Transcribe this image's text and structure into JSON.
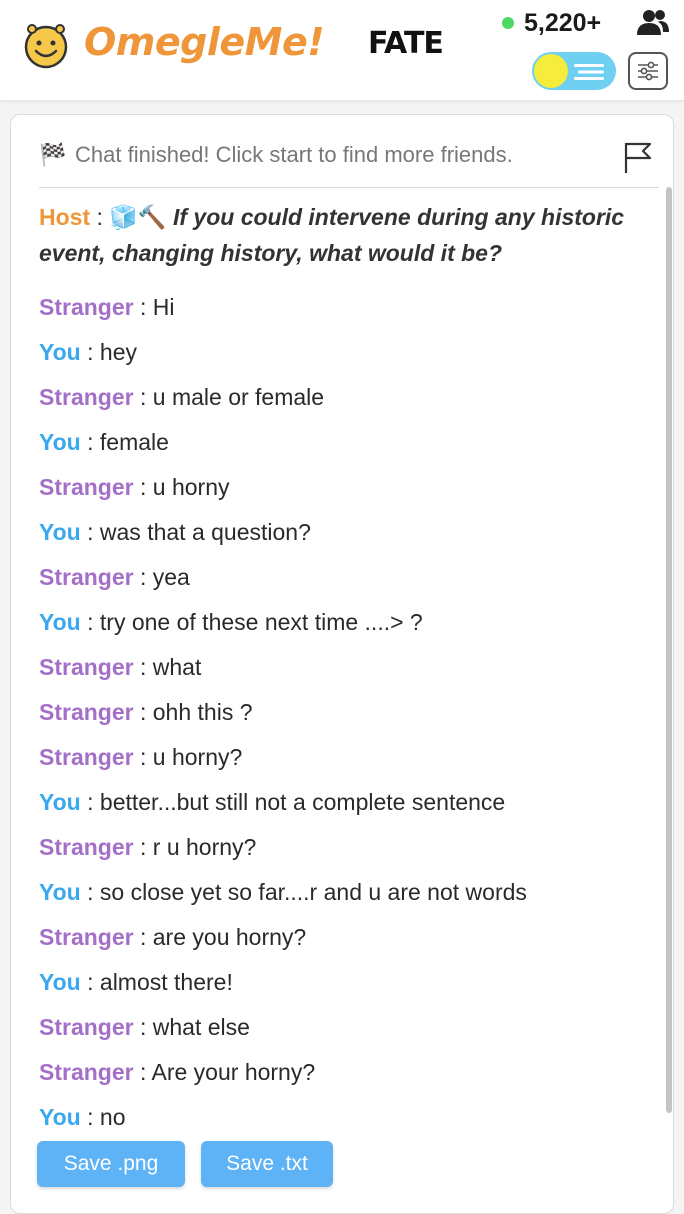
{
  "header": {
    "logo_text": "OmegleMe!",
    "brand_word": "FATE",
    "online_count": "5,220+",
    "online_color": "#4cd964",
    "accent_color": "#f0963a"
  },
  "status": {
    "flag_icon": "🏁",
    "text": "Chat finished! Click start to find more friends."
  },
  "host_message": {
    "name": "Host",
    "icons": "🧊🔨",
    "text": "If you could intervene during any historic event, changing history, what would it be?"
  },
  "messages": [
    {
      "speaker": "Stranger",
      "text": "Hi"
    },
    {
      "speaker": "You",
      "text": "hey"
    },
    {
      "speaker": "Stranger",
      "text": "u male or female"
    },
    {
      "speaker": "You",
      "text": "female"
    },
    {
      "speaker": "Stranger",
      "text": "u horny"
    },
    {
      "speaker": "You",
      "text": "was that a question?"
    },
    {
      "speaker": "Stranger",
      "text": "yea"
    },
    {
      "speaker": "You",
      "text": "try one of these next time ....> ?"
    },
    {
      "speaker": "Stranger",
      "text": "what"
    },
    {
      "speaker": "Stranger",
      "text": "ohh this ?"
    },
    {
      "speaker": "Stranger",
      "text": "u horny?"
    },
    {
      "speaker": "You",
      "text": "better...but still not a complete sentence"
    },
    {
      "speaker": "Stranger",
      "text": "r u horny?"
    },
    {
      "speaker": "You",
      "text": "so close yet so far....r and u are not words"
    },
    {
      "speaker": "Stranger",
      "text": "are you horny?"
    },
    {
      "speaker": "You",
      "text": "almost there!"
    },
    {
      "speaker": "Stranger",
      "text": "what else"
    },
    {
      "speaker": "Stranger",
      "text": "Are your horny?"
    },
    {
      "speaker": "You",
      "text": "no"
    }
  ],
  "buttons": {
    "save_png": "Save .png",
    "save_txt": "Save .txt"
  },
  "colors": {
    "stranger": "#a46fc6",
    "you": "#3aa8ee",
    "host": "#f0963a",
    "button": "#5db3f5"
  }
}
